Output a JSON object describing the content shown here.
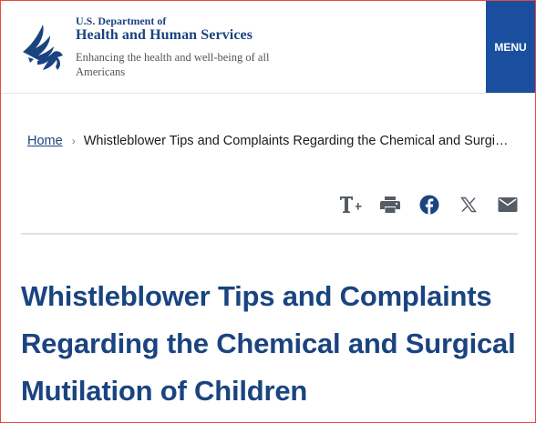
{
  "header": {
    "agency_top": "U.S. Department of",
    "agency_name": "Health and Human Services",
    "tagline": "Enhancing the health and well-being of all Americans",
    "menu_label": "MENU"
  },
  "breadcrumb": {
    "home": "Home",
    "separator": "›",
    "current": "Whistleblower Tips and Complaints Regarding the Chemical and Surgical Mutilation of Children"
  },
  "toolbar": {
    "icons": [
      "text-size-icon",
      "print-icon",
      "facebook-icon",
      "x-icon",
      "email-icon"
    ]
  },
  "page": {
    "title": "Whistleblower Tips and Complaints Regarding the Chemical and Surgical Mutilation of Children"
  },
  "colors": {
    "brand_blue": "#1a4480",
    "menu_bg": "#1a4fa0",
    "icon_gray": "#565c65"
  }
}
